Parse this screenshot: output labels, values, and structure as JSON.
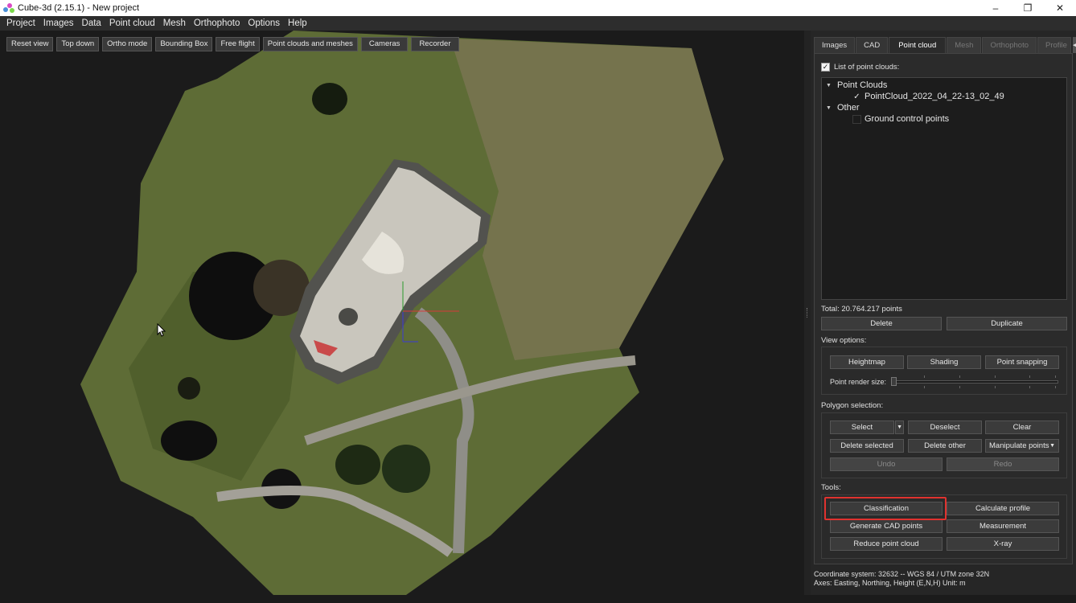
{
  "window": {
    "title": "Cube-3d (2.15.1) - New project",
    "controls": {
      "minimize": "–",
      "maximize": "❐",
      "close": "✕"
    }
  },
  "menu": [
    "Project",
    "Images",
    "Data",
    "Point cloud",
    "Mesh",
    "Orthophoto",
    "Options",
    "Help"
  ],
  "viewport": {
    "buttons": [
      "Reset view",
      "Top down",
      "Ortho mode",
      "Bounding Box",
      "Free flight",
      "Point clouds and meshes",
      "Cameras",
      "Recorder"
    ]
  },
  "tabs": [
    {
      "label": "Images",
      "state": "normal"
    },
    {
      "label": "CAD",
      "state": "normal"
    },
    {
      "label": "Point cloud",
      "state": "active"
    },
    {
      "label": "Mesh",
      "state": "disabled"
    },
    {
      "label": "Orthophoto",
      "state": "disabled"
    },
    {
      "label": "Profile",
      "state": "disabled"
    }
  ],
  "point_cloud": {
    "list_label": "List of point clouds:",
    "list_checked": true,
    "tree": {
      "group1": "Point Clouds",
      "item1": "PointCloud_2022_04_22-13_02_49",
      "item1_checked": "✓",
      "group2": "Other",
      "item2": "Ground control points"
    },
    "total": "Total: 20.764.217 points",
    "delete_label": "Delete",
    "duplicate_label": "Duplicate",
    "view_options_label": "View options:",
    "view_buttons": [
      "Heightmap",
      "Shading",
      "Point snapping"
    ],
    "render_size_label": "Point render size:",
    "polygon_label": "Polygon selection:",
    "polygon_buttons": {
      "select": "Select",
      "deselect": "Deselect",
      "clear": "Clear",
      "delete_selected": "Delete selected",
      "delete_other": "Delete other",
      "manipulate": "Manipulate points",
      "undo": "Undo",
      "redo": "Redo"
    },
    "tools_label": "Tools:",
    "tools": {
      "classification": "Classification",
      "calculate_profile": "Calculate profile",
      "generate_cad": "Generate CAD points",
      "measurement": "Measurement",
      "reduce": "Reduce point cloud",
      "xray": "X-ray"
    }
  },
  "status": {
    "line1": "Coordinate system: 32632 -- WGS 84 / UTM zone 32N",
    "line2": "Axes: Easting, Northing, Height (E,N,H) Unit: m"
  },
  "colors": {
    "highlight": "#e0322f",
    "grass": "#5a6b34",
    "concrete": "#c9c6bd"
  }
}
